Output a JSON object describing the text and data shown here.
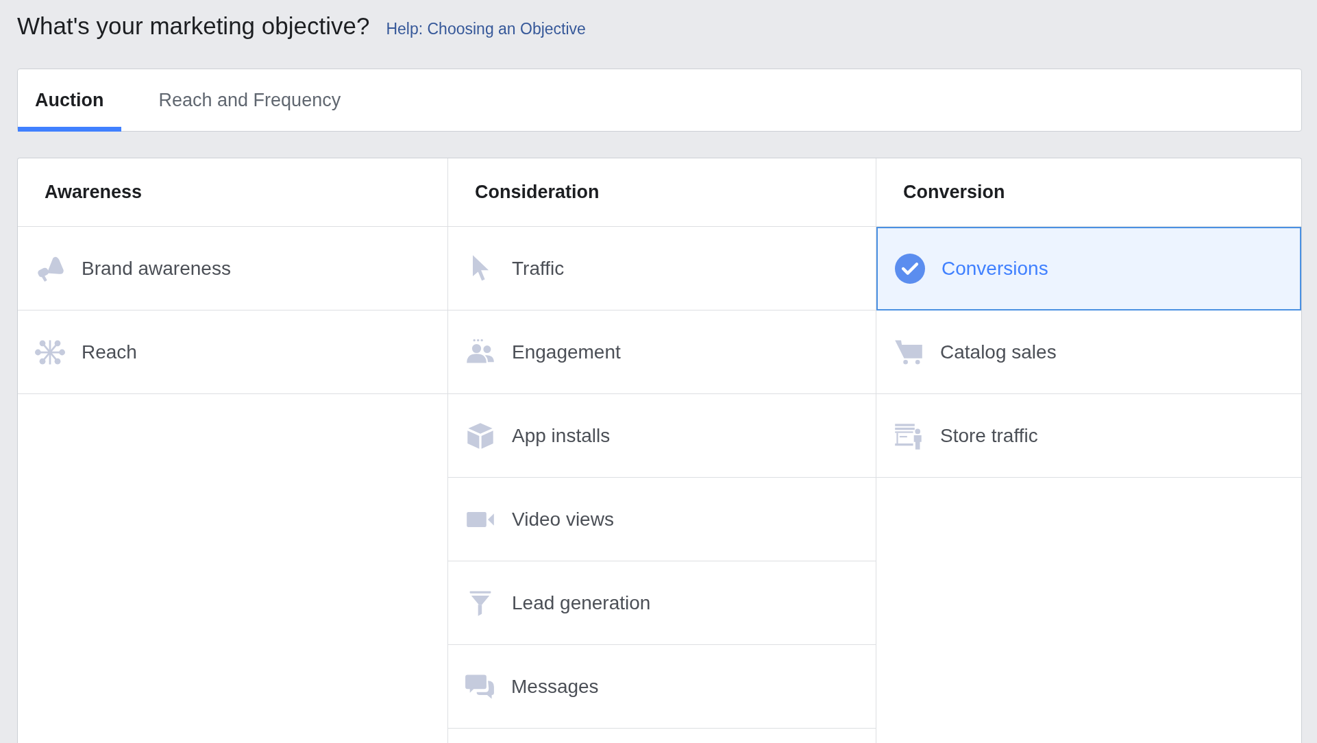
{
  "heading": {
    "title": "What's your marketing objective?",
    "help_link": "Help: Choosing an Objective"
  },
  "tabs": [
    {
      "label": "Auction",
      "selected": true
    },
    {
      "label": "Reach and Frequency",
      "selected": false
    }
  ],
  "columns": [
    {
      "title": "Awareness",
      "items": [
        {
          "label": "Brand awareness",
          "kind": "megaphone",
          "selected": false
        },
        {
          "label": "Reach",
          "kind": "reach",
          "selected": false
        }
      ]
    },
    {
      "title": "Consideration",
      "items": [
        {
          "label": "Traffic",
          "kind": "cursor",
          "selected": false
        },
        {
          "label": "Engagement",
          "kind": "people",
          "selected": false
        },
        {
          "label": "App installs",
          "kind": "cube",
          "selected": false
        },
        {
          "label": "Video views",
          "kind": "video",
          "selected": false
        },
        {
          "label": "Lead generation",
          "kind": "funnel",
          "selected": false
        },
        {
          "label": "Messages",
          "kind": "chat",
          "selected": false
        }
      ]
    },
    {
      "title": "Conversion",
      "items": [
        {
          "label": "Conversions",
          "selected": true
        },
        {
          "label": "Catalog sales",
          "kind": "cart",
          "selected": false
        },
        {
          "label": "Store traffic",
          "kind": "store",
          "selected": false
        }
      ]
    }
  ]
}
